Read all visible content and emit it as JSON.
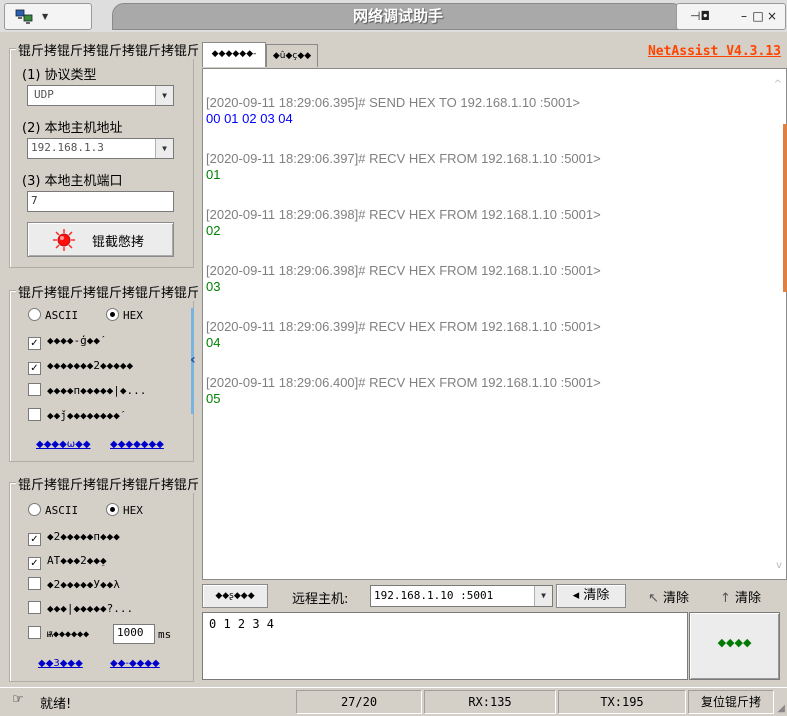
{
  "window": {
    "title": "网络调试助手"
  },
  "left_panel": {
    "network_settings": {
      "title": "锟斤拷锟斤拷锟斤拷锟斤拷锟斤拷",
      "protocol_label": "(1) 协议类型",
      "protocol_value": "UDP",
      "local_ip_label": "(2) 本地主机地址",
      "local_ip_value": "192.168.1.3",
      "local_port_label": "(3) 本地主机端口",
      "local_port_value": "7",
      "connect_button": "锟截憋拷"
    },
    "recv_settings": {
      "title": "锟斤拷锟斤拷锟斤拷锟斤拷锟斤拷锟斤拷",
      "ascii_label": "ASCII",
      "hex_label": "HEX",
      "options": [
        {
          "label": "◆◆◆◆-ģ◆◆ˊ",
          "checked": true
        },
        {
          "label": "◆◆◆◆◆◆◆2◆◆◆◆◆",
          "checked": true
        },
        {
          "label": "◆◆◆◆п◆◆◆◆◆|◆...",
          "checked": false
        },
        {
          "label": "◆◆ǰ◆◆◆◆◆◆◆◆ˊ",
          "checked": false
        }
      ],
      "link_left": "◆◆◆◆ω◆◆",
      "link_right": "◆◆◆◆◆◆◆"
    },
    "send_settings": {
      "title": "锟斤拷锟斤拷锟斤拷锟斤拷锟斤拷锟斤拷",
      "ascii_label": "ASCII",
      "hex_label": "HEX",
      "options": [
        {
          "label": "◆2◆◆◆◆◆п◆◆◆",
          "checked": true
        },
        {
          "label": "AT◆◆◆2◆◆ֵ◆",
          "checked": true
        },
        {
          "label": "◆2◆◆◆◆◆У◆◆λ",
          "checked": false
        },
        {
          "label": "◆◆◆|◆◆◆◆◆?...",
          "checked": false
        }
      ],
      "interval_label": "ѭ◆◆◆◆◆◆",
      "interval_value": "1000",
      "interval_unit": "ms",
      "link_left": "◆◆3◆◆◆",
      "link_right": "◆◆-◆◆◆◆"
    }
  },
  "tabs": [
    {
      "label": "◆◆◆◆◆◆-"
    },
    {
      "label": "◆û◆ç◆◆"
    }
  ],
  "version": "NetAssist V4.3.13",
  "log": [
    {
      "header": "[2020-09-11 18:29:06.395]# SEND HEX TO 192.168.1.10 :5001>",
      "data": "00 01 02 03 04",
      "color": "#0000ff"
    },
    {
      "header": "[2020-09-11 18:29:06.397]# RECV HEX FROM 192.168.1.10 :5001>",
      "data": "01",
      "color": "#008000"
    },
    {
      "header": "[2020-09-11 18:29:06.398]# RECV HEX FROM 192.168.1.10 :5001>",
      "data": "02",
      "color": "#008000"
    },
    {
      "header": "[2020-09-11 18:29:06.398]# RECV HEX FROM 192.168.1.10 :5001>",
      "data": "03",
      "color": "#008000"
    },
    {
      "header": "[2020-09-11 18:29:06.399]# RECV HEX FROM 192.168.1.10 :5001>",
      "data": "04",
      "color": "#008000"
    },
    {
      "header": "[2020-09-11 18:29:06.400]# RECV HEX FROM 192.168.1.10 :5001>",
      "data": "05",
      "color": "#008000"
    }
  ],
  "send_bar": {
    "mode_button": "◆◆ʂ◆◆◆",
    "remote_label": "远程主机:",
    "remote_value": "192.168.1.10 :5001",
    "clear_history": "清除",
    "clear_recv": "清除",
    "clear_count": "清除"
  },
  "send_box": {
    "value": "0 1 2 3 4"
  },
  "send_button": "◆◆◆◆",
  "status_bar": {
    "ready": "就绪!",
    "count": "27/20",
    "rx": "RX:135",
    "tx": "TX:195",
    "reset": "复位锟斤拷"
  }
}
